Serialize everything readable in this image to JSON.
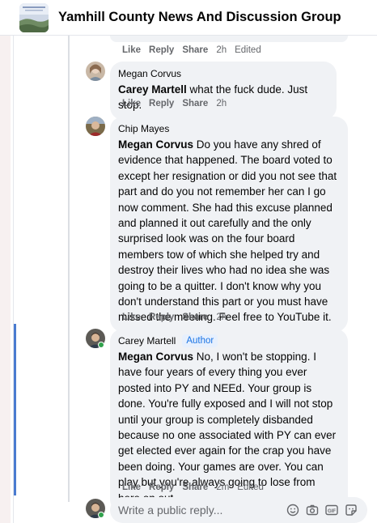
{
  "group": {
    "title": "Yamhill County News And Discussion Group"
  },
  "comments": [
    {
      "id": "c0",
      "actions": {
        "like": "Like",
        "reply": "Reply",
        "share": "Share",
        "time": "2h",
        "edited": "Edited"
      }
    },
    {
      "id": "c1",
      "author": "Megan Corvus",
      "mention": "Carey Martell",
      "text": " what the fuck dude. Just stop.",
      "actions": {
        "like": "Like",
        "reply": "Reply",
        "share": "Share",
        "time": "2h"
      }
    },
    {
      "id": "c2",
      "author": "Chip Mayes",
      "mention": "Megan Corvus",
      "text": " Do you have any shred of evidence that happened. The board voted to except her resignation or did you not see that part and do you not remember her can I go now comment. She had this excuse planned and planned it out carefully and the only surprised look was on the four board members tow of which she helped try and destroy their lives who had no idea she was going to be a quitter. I don't know why you don't understand this part or you must have missed the meeting. Feel free to YouTube it.",
      "actions": {
        "like": "Like",
        "reply": "Reply",
        "share": "Share",
        "time": "2h"
      }
    },
    {
      "id": "c3",
      "author": "Carey Martell",
      "badge": "Author",
      "mention": "Megan Corvus",
      "text": " No, I won't be stopping. I have four years of every thing you ever posted into PY and NEEd. Your group is done. You're fully exposed and I will not stop until your group is completely disbanded because no one associated with PY can ever get elected ever again for the crap you have been doing. Your games are over. You can play but you're always going to lose from here on out.",
      "actions": {
        "like": "Like",
        "reply": "Reply",
        "share": "Share",
        "time": "2m",
        "edited": "Edited"
      }
    }
  ],
  "composer": {
    "placeholder": "Write a public reply...",
    "tools": [
      "emoji-icon",
      "camera-icon",
      "gif-icon",
      "sticker-icon"
    ]
  }
}
